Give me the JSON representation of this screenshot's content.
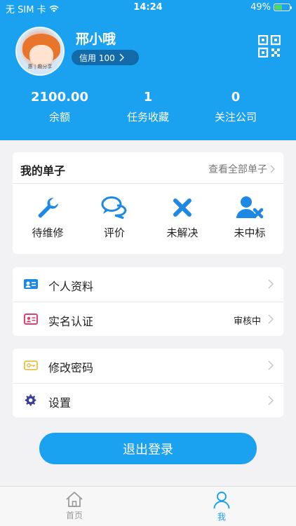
{
  "status_bar": {
    "carrier": "无 SIM 卡",
    "time": "14:24",
    "battery": "49%",
    "battery_level": 0.49
  },
  "profile": {
    "avatar_caption": "惠 | 趣分享",
    "name": "邢小哦",
    "credit_label": "信用 100"
  },
  "stats": [
    {
      "value": "2100.00",
      "label": "余额"
    },
    {
      "value": "1",
      "label": "任务收藏"
    },
    {
      "value": "0",
      "label": "关注公司"
    }
  ],
  "orders": {
    "title": "我的单子",
    "view_all": "查看全部单子",
    "items": [
      {
        "label": "待维修",
        "icon": "wrench-icon"
      },
      {
        "label": "评价",
        "icon": "chat-bubbles-icon"
      },
      {
        "label": "未解决",
        "icon": "cross-icon"
      },
      {
        "label": "未中标",
        "icon": "user-cross-icon"
      }
    ]
  },
  "menu1": [
    {
      "label": "个人资料",
      "icon": "id-card-icon",
      "status": ""
    },
    {
      "label": "实名认证",
      "icon": "real-name-card-icon",
      "status": "审核中"
    }
  ],
  "menu2": [
    {
      "label": "修改密码",
      "icon": "password-icon",
      "status": ""
    },
    {
      "label": "设置",
      "icon": "gear-icon",
      "status": ""
    }
  ],
  "logout_label": "退出登录",
  "tabs": [
    {
      "label": "首页",
      "icon": "home-icon"
    },
    {
      "label": "我",
      "icon": "person-icon"
    }
  ],
  "colors": {
    "primary": "#1aa1f0",
    "icon_blue": "#1e88e5",
    "id_icon_red": "#e0426e",
    "password_icon_yellow": "#e8c14a",
    "gear_icon": "#3c3f9a"
  }
}
